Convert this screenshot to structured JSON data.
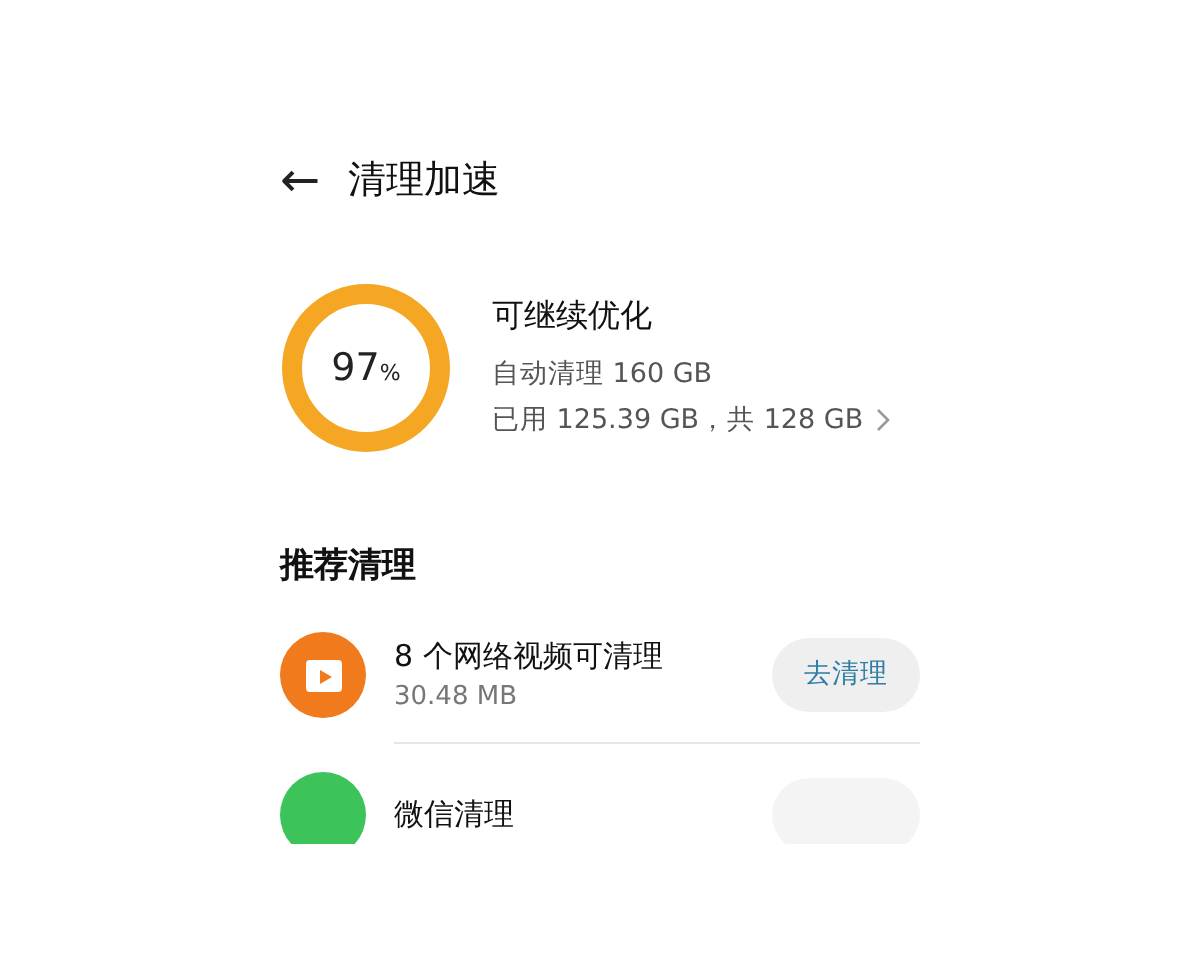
{
  "header": {
    "back": "←",
    "title": "清理加速"
  },
  "storage": {
    "percent": "97",
    "percent_sign": "%",
    "status": "可继续优化",
    "auto_clean": "自动清理 160 GB",
    "usage": "已用 125.39 GB，共 128 GB"
  },
  "recommend": {
    "title": "推荐清理",
    "items": [
      {
        "kind": "video",
        "title": "8 个网络视频可清理",
        "size": "30.48 MB",
        "button": "去清理",
        "color": "#f07a1c"
      },
      {
        "kind": "wechat",
        "title": "微信清理",
        "color": "#3cc35a"
      }
    ]
  }
}
